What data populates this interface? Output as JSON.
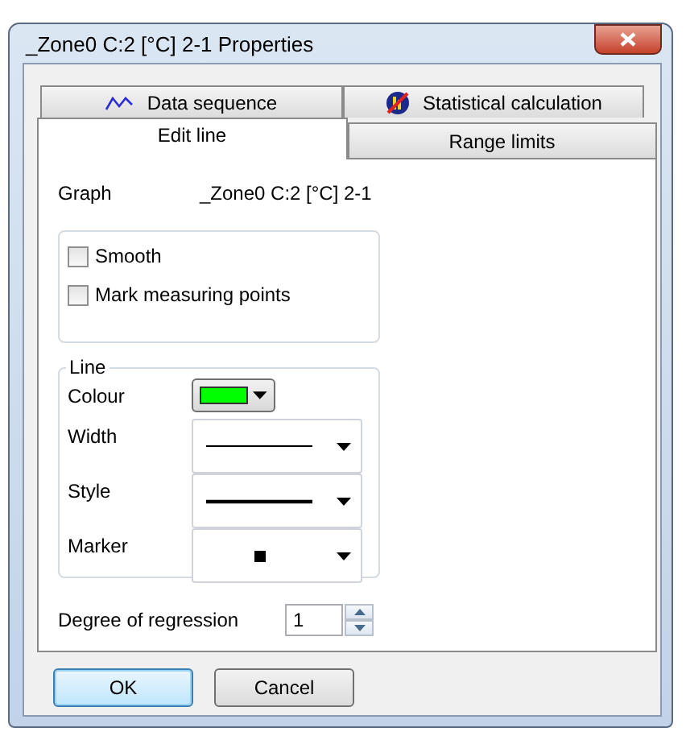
{
  "window": {
    "title": "_Zone0 C:2 [°C] 2-1 Properties"
  },
  "tab_rows": [
    [
      {
        "label": "Data sequence",
        "kind": "line-chart",
        "selected": false
      },
      {
        "label": "Statistical calculation",
        "kind": "statistics",
        "selected": false
      }
    ],
    [
      {
        "label": "Edit line",
        "selected": true
      },
      {
        "label": "Range limits",
        "selected": false
      }
    ]
  ],
  "graph": {
    "label": "Graph",
    "value": "_Zone0 C:2 [°C] 2-1"
  },
  "options": [
    {
      "label": "Smooth",
      "checked": false
    },
    {
      "label": "Mark measuring points",
      "checked": false
    }
  ],
  "line_group": {
    "title": "Line",
    "colour": {
      "label": "Colour",
      "color": "#00ff00"
    },
    "rows": [
      {
        "label": "Width",
        "kind": "thin-line"
      },
      {
        "label": "Style",
        "kind": "thick-line"
      },
      {
        "label": "Marker",
        "kind": "square-marker"
      }
    ]
  },
  "regression": {
    "label": "Degree of regression",
    "value": "1"
  },
  "buttons": [
    {
      "label": "OK",
      "default": true
    },
    {
      "label": "Cancel",
      "default": false
    }
  ]
}
